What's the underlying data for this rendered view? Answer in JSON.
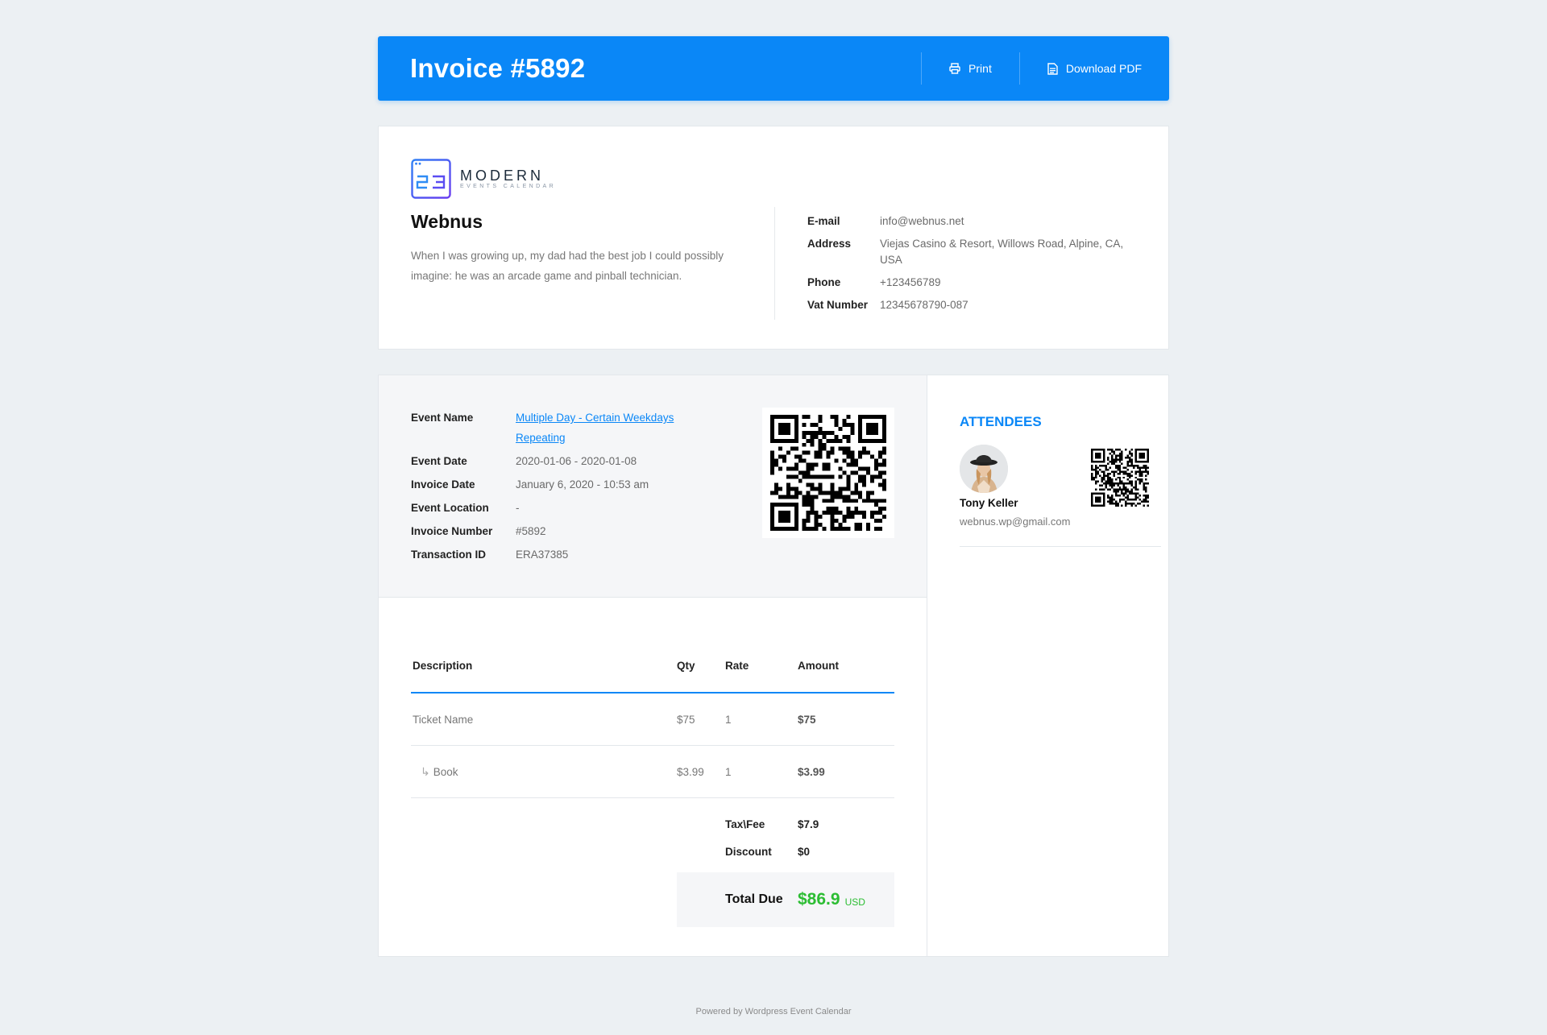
{
  "header": {
    "title": "Invoice #5892",
    "print_label": "Print",
    "download_label": "Download PDF"
  },
  "company": {
    "logo_main": "MODERN",
    "logo_sub": "EVENTS CALENDAR",
    "name": "Webnus",
    "description": "When I was growing up, my dad had the best job I could possibly imagine: he was an arcade game and pinball technician.",
    "info": [
      {
        "label": "E-mail",
        "value": "info@webnus.net"
      },
      {
        "label": "Address",
        "value": "Viejas Casino & Resort, Willows Road, Alpine, CA, USA"
      },
      {
        "label": "Phone",
        "value": "+123456789"
      },
      {
        "label": "Vat Number",
        "value": "12345678790-087"
      }
    ]
  },
  "event": {
    "details": [
      {
        "label": "Event Name",
        "value": "Multiple Day - Certain Weekdays Repeating"
      },
      {
        "label": "Event Date",
        "value": "2020-01-06 - 2020-01-08"
      },
      {
        "label": "Invoice Date",
        "value": "January 6, 2020 - 10:53 am"
      },
      {
        "label": "Event Location",
        "value": "-"
      },
      {
        "label": "Invoice Number",
        "value": "#5892"
      },
      {
        "label": "Transaction ID",
        "value": "ERA37385"
      }
    ]
  },
  "table": {
    "headers": [
      "Description",
      "Qty",
      "Rate",
      "Amount"
    ],
    "rows": [
      {
        "description": "Ticket Name",
        "qty": "$75",
        "rate": "1",
        "amount": "$75"
      },
      {
        "description": "Book",
        "qty": "$3.99",
        "rate": "1",
        "amount": "$3.99"
      }
    ],
    "tax_label": "Tax\\Fee",
    "tax_value": "$7.9",
    "discount_label": "Discount",
    "discount_value": "$0",
    "total_label": "Total Due",
    "total_value": "$86.9",
    "currency": "USD"
  },
  "attendees": {
    "title": "ATTENDEES",
    "list": [
      {
        "name": "Tony Keller",
        "email": "webnus.wp@gmail.com"
      }
    ]
  },
  "footer": "Powered by Wordpress Event Calendar",
  "colors": {
    "accent": "#0a87f7",
    "total_green": "#2cbd33",
    "background": "#ecf0f3"
  }
}
